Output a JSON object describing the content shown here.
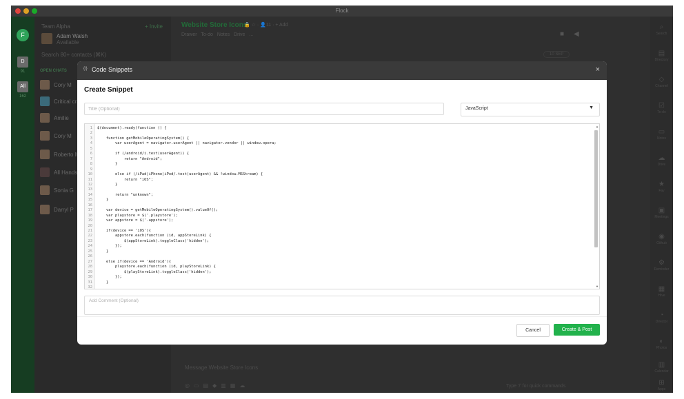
{
  "window": {
    "title": "Flock"
  },
  "rail": {
    "logo": "F",
    "teams": [
      {
        "label": "D",
        "count": "91"
      },
      {
        "label": "All",
        "count": "162"
      }
    ]
  },
  "sidebar": {
    "team_name": "Team Alpha",
    "invite": "+ Invite",
    "user_name": "Adam Walsh",
    "user_status": "Available",
    "search_placeholder": "Search 80+ contacts (⌘K)",
    "open_chats_label": "OPEN CHATS",
    "chats": [
      "Cory M",
      "Critical cra",
      "Amilie",
      "Cory M",
      "Roberto M",
      "All Hands",
      "Sonia G",
      "Darryl P"
    ]
  },
  "channel": {
    "title": "Website Store Icons",
    "meta": "🔒 ☆ · 👤11 · + Add",
    "tabs": [
      "Drawer",
      "To-do",
      "Notes",
      "Drive",
      "..."
    ],
    "date_label": "10 SEP",
    "message_placeholder": "Message Website Store Icons",
    "hint": "Type '/' for quick commands"
  },
  "apps": [
    {
      "icon": "⌕",
      "label": "Search"
    },
    {
      "icon": "▤",
      "label": "Directory"
    },
    {
      "icon": "◇",
      "label": "Channel"
    },
    {
      "icon": "☑",
      "label": "To-do"
    },
    {
      "icon": "▭",
      "label": "Notes"
    },
    {
      "icon": "☁",
      "label": "Drive"
    },
    {
      "icon": "★",
      "label": "Fav"
    },
    {
      "icon": "▣",
      "label": "Meetings"
    },
    {
      "icon": "◉",
      "label": "Github"
    },
    {
      "icon": "⚙",
      "label": "Reminder"
    },
    {
      "icon": "▦",
      "label": "Hive"
    },
    {
      "icon": "◔",
      "label": "Director"
    },
    {
      "icon": "◐",
      "label": "Photos"
    },
    {
      "icon": "▥",
      "label": "Calendar"
    },
    {
      "icon": "⊞",
      "label": "Apps"
    }
  ],
  "modal": {
    "header_icon": "{/}",
    "header_title": "Code Snippets",
    "close": "×",
    "title": "Create Snippet",
    "title_placeholder": "Title (Optional)",
    "language": "JavaScript",
    "language_arrow": "▼",
    "comment_placeholder": "Add Comment (Optional)",
    "cancel_label": "Cancel",
    "create_label": "Create & Post"
  },
  "code": {
    "lines": [
      "$(document).ready(function () {",
      "",
      "    function getMobileOperatingSystem() {",
      "        var userAgent = navigator.userAgent || navigator.vendor || window.opera;",
      "",
      "        if (/android/i.test(userAgent)) {",
      "            return \"Android\";",
      "        }",
      "",
      "        else if (/iPad|iPhone|iPod/.test(userAgent) && !window.MSStream) {",
      "            return \"iOS\";",
      "        }",
      "",
      "        return \"unknown\";",
      "    }",
      "",
      "    var device = getMobileOperatingSystem().valueOf();",
      "    var playstore = $('.playstore');",
      "    var appstore = $('.appstore');",
      "",
      "    if(device == 'iOS'){",
      "        appstore.each(function (id, appStoreLink) {",
      "            $(appStoreLink).toggleClass('hidden');",
      "        });",
      "    }",
      "",
      "    else if(device == 'Android'){",
      "        playstore.each(function (id, playStoreLink) {",
      "            $(playStoreLink).toggleClass('hidden');",
      "        });",
      "    }",
      ""
    ]
  }
}
